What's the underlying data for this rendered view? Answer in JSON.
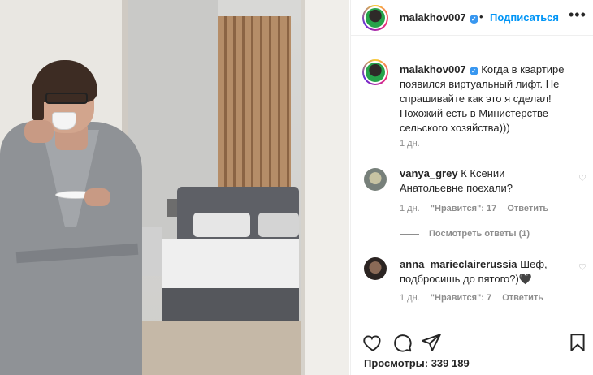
{
  "post": {
    "author": "malakhov007",
    "follow_label": "Подписаться",
    "dot": "•",
    "more": "•••",
    "caption": "Когда в квартире появился виртуальный лифт. Не спрашивайте как это я сделал! Похожий есть в Министерстве сельского хозяйства)))",
    "caption_time": "1 дн."
  },
  "comments": [
    {
      "user": "vanya_grey",
      "text": "К Ксении Анатольевне поехали?",
      "time": "1 дн.",
      "likes": "\"Нравится\": 17",
      "reply": "Ответить",
      "view_replies": "Посмотреть ответы (1)"
    },
    {
      "user": "anna_marieclairerussia",
      "text": "Шеф, подбросишь до пятого?)🖤",
      "time": "1 дн.",
      "likes": "\"Нравится\": 7",
      "reply": "Ответить"
    }
  ],
  "footer": {
    "views": "Просмотры: 339 189"
  },
  "icons": {
    "like": "heart-icon",
    "comment": "comment-icon",
    "share": "paper-plane-icon",
    "save": "bookmark-icon",
    "verified": "verified-badge-icon",
    "comment_like": "small-heart-icon"
  },
  "colors": {
    "accent": "#0095f6",
    "verified": "#3897f0",
    "text": "#262626",
    "muted": "#8e8e8e"
  }
}
